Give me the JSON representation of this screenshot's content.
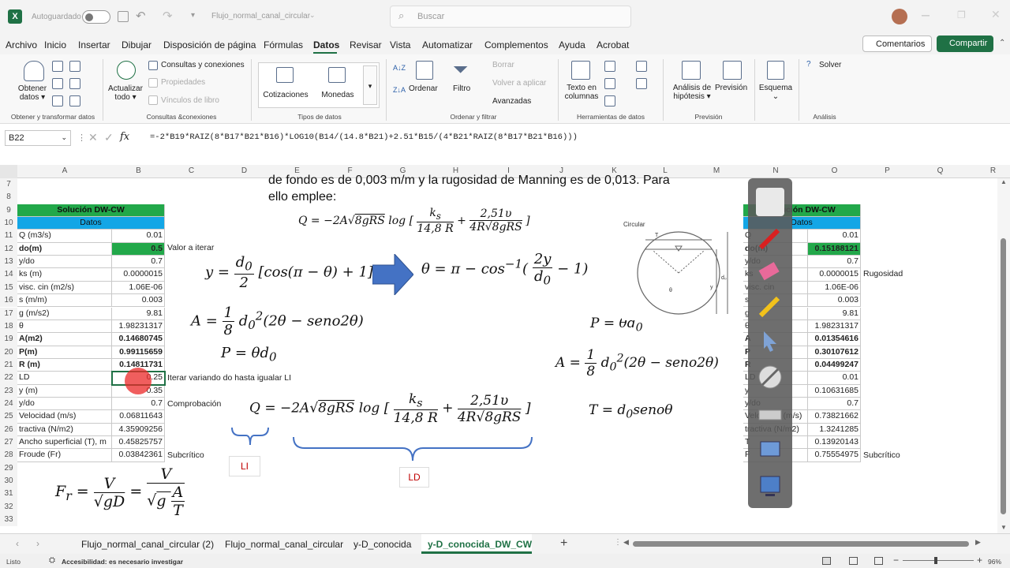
{
  "titlebar": {
    "autosave": "Autoguardado",
    "doc_title": "Flujo_normal_canal_circular",
    "search_placeholder": "Buscar"
  },
  "menu": [
    "Archivo",
    "Inicio",
    "Insertar",
    "Dibujar",
    "Disposición de página",
    "Fórmulas",
    "Datos",
    "Revisar",
    "Vista",
    "Automatizar",
    "Complementos",
    "Ayuda",
    "Acrobat"
  ],
  "active_menu": "Datos",
  "comments_btn": "Comentarios",
  "share_btn": "Compartir",
  "ribbon": {
    "get_data": "Obtener datos",
    "from_text": "",
    "refresh_all": "Actualizar todo",
    "queries": "Consultas y conexiones",
    "properties": "Propiedades",
    "links": "Vínculos de libro",
    "stocks": "Cotizaciones",
    "currencies": "Monedas",
    "sort": "Ordenar",
    "filter": "Filtro",
    "clear": "Borrar",
    "reapply": "Volver a aplicar",
    "advanced": "Avanzadas",
    "text_to_cols": "Texto en columnas",
    "whatif": "Análisis de hipótesis",
    "forecast": "Previsión",
    "outline": "Esquema",
    "solver": "Solver",
    "groups": [
      "Obtener y transformar datos",
      "Consultas &conexiones",
      "Tipos de datos",
      "Ordenar y filtrar",
      "Herramientas de datos",
      "Previsión",
      "Análisis"
    ]
  },
  "namebox": "B22",
  "formula": "=-2*B19*RAIZ(8*B17*B21*B16)*LOG10(B14/(14.8*B21)+2.51*B15/(4*B21*RAIZ(8*B17*B21*B16)))",
  "columns": [
    "A",
    "B",
    "C",
    "D",
    "E",
    "F",
    "G",
    "H",
    "I",
    "J",
    "K",
    "L",
    "M",
    "N",
    "O",
    "P",
    "Q",
    "R"
  ],
  "rows": [
    "7",
    "8",
    "9",
    "10",
    "11",
    "12",
    "13",
    "14",
    "15",
    "16",
    "17",
    "18",
    "19",
    "20",
    "21",
    "22",
    "23",
    "24",
    "25",
    "26",
    "27",
    "28",
    "29",
    "30",
    "31",
    "32",
    "33"
  ],
  "left_table": {
    "title": "Solución DW-CW",
    "subtitle": "Datos",
    "rows": [
      {
        "label": "Q (m3/s)",
        "value": "0.01"
      },
      {
        "label": "do(m)",
        "value": "0.5"
      },
      {
        "label": "y/do",
        "value": "0.7"
      },
      {
        "label": "ks (m)",
        "value": "0.0000015"
      },
      {
        "label": "visc. cin (m2/s)",
        "value": "1.06E-06"
      },
      {
        "label": "s (m/m)",
        "value": "0.003"
      },
      {
        "label": "g (m/s2)",
        "value": "9.81"
      },
      {
        "label": "θ",
        "value": "1.98231317"
      },
      {
        "label": "A(m2)",
        "value": "0.14680745"
      },
      {
        "label": "P(m)",
        "value": "0.99115659"
      },
      {
        "label": "R (m)",
        "value": "0.14811731"
      },
      {
        "label": "LD",
        "value": "0.25"
      },
      {
        "label": "y (m)",
        "value": "0.35"
      },
      {
        "label": "y/do",
        "value": "0.7"
      },
      {
        "label": "Velocidad (m/s)",
        "value": "0.06811643"
      },
      {
        "label": "tractiva (N/m2)",
        "value": "4.35909256"
      },
      {
        "label": "Ancho superficial (T), m",
        "value": "0.45825757"
      },
      {
        "label": "Froude (Fr)",
        "value": "0.03842361"
      }
    ]
  },
  "notes": {
    "iterar": "Valor a iterar",
    "variando": "Iterar variando do hasta igualar LI",
    "comprobacion": "Comprobación",
    "subcritico_left": "Subcrítico",
    "subcritico_right": "Subcrítico",
    "rugosidad": "Rugosidad"
  },
  "right_table": {
    "title": "Solución DW-CW",
    "subtitle": "Datos",
    "labels": [
      "Q",
      "do(m)",
      "y/do",
      "ks",
      "visc. cin",
      "s",
      "g",
      "θ",
      "A",
      "P",
      "R",
      "LD",
      "y",
      "y/do",
      "Velocidad (m/s)",
      "tractiva (N/m2)",
      "T",
      "F"
    ],
    "values": [
      "0.01",
      "0.15188121",
      "0.7",
      "0.0000015",
      "1.06E-06",
      "0.003",
      "9.81",
      "1.98231317",
      "0.01354616",
      "0.30107612",
      "0.04499247",
      "0.01",
      "0.10631685",
      "0.7",
      "0.73821662",
      "1.3241285",
      "0.13920143",
      "0.75554975"
    ]
  },
  "overlay": {
    "text_line1": "de fondo es de 0,003 m/m y la rugosidad de Manning es de 0,013. Para",
    "text_line2": "ello emplee:",
    "circular_label": "Circular",
    "li": "LI",
    "ld": "LD"
  },
  "tabs": [
    "Flujo_normal_canal_circular (2)",
    "Flujo_normal_canal_circular",
    "y-D_conocida",
    "y-D_conocida_DW_CW"
  ],
  "active_tab": "y-D_conocida_DW_CW",
  "status": {
    "ready": "Listo",
    "accessibility": "Accesibilidad: es necesario investigar",
    "zoom": "96%"
  }
}
